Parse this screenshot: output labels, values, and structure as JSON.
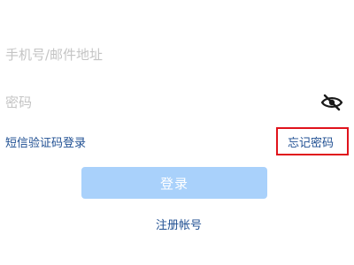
{
  "login_form": {
    "phone_email": {
      "placeholder": "手机号/邮件地址",
      "value": ""
    },
    "password": {
      "placeholder": "密码",
      "value": "",
      "visibility_icon": "eye-off-icon"
    },
    "sms_login_link": "短信验证码登录",
    "forgot_password_link": "忘记密码",
    "login_button": "登录",
    "register_link": "注册帐号"
  },
  "colors": {
    "link": "#1f4f92",
    "login_button_disabled": "#a9d1fb",
    "highlight_box": "#e0131c",
    "placeholder": "#c4c4c4"
  }
}
